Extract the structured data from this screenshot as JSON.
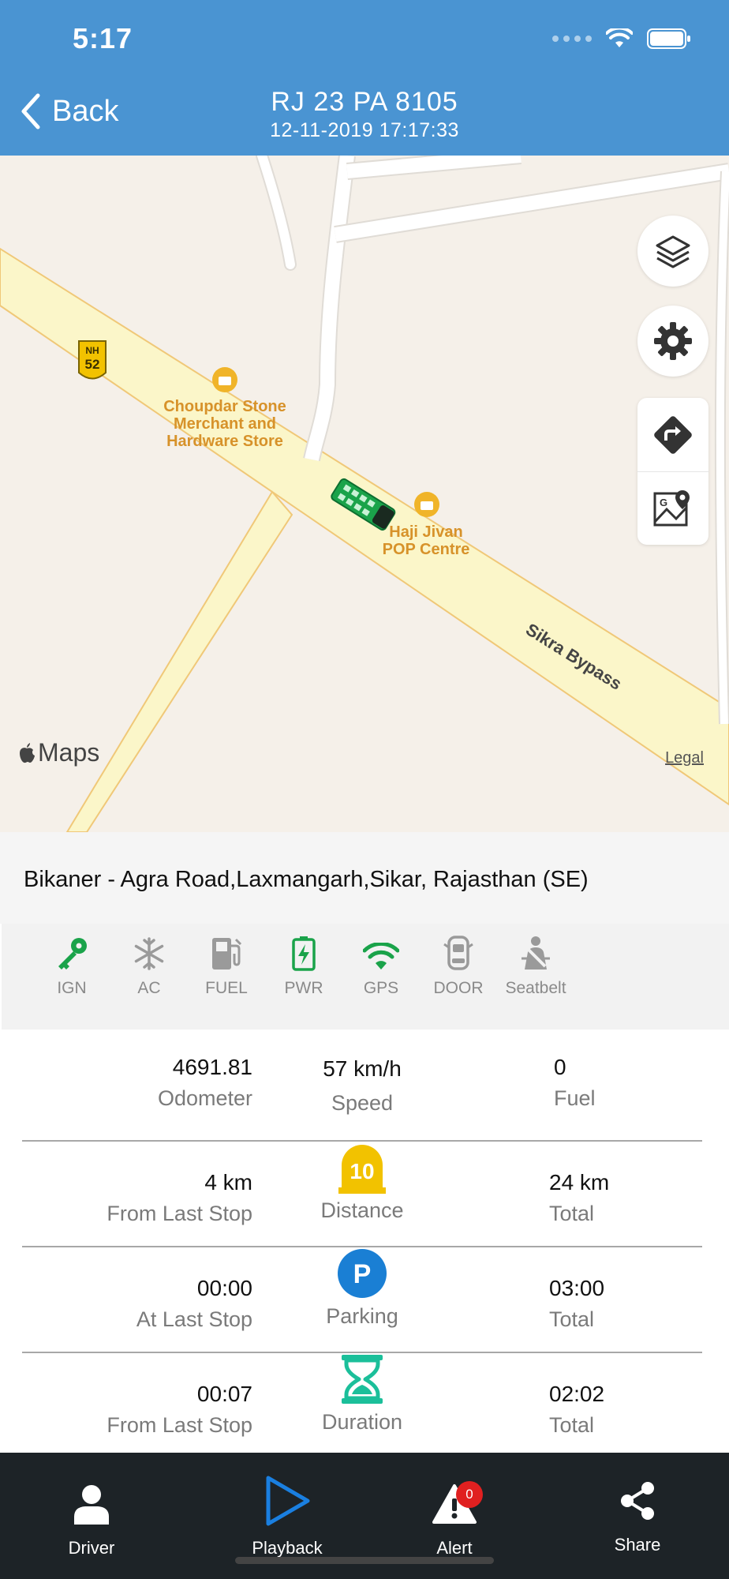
{
  "status_bar": {
    "time": "5:17"
  },
  "header": {
    "back_label": "Back",
    "title": "RJ 23 PA 8105",
    "subtitle": "12-11-2019 17:17:33"
  },
  "map": {
    "shield_top": "NH",
    "shield_num": "52",
    "poi_1": [
      "Choupdar Stone",
      "Merchant and",
      "Hardware Store"
    ],
    "poi_2": [
      "Haji Jivan",
      "POP Centre"
    ],
    "road_label": "Sikra Bypass",
    "maps_brand": "Maps",
    "legal": "Legal"
  },
  "address": "Bikaner - Agra Road,Laxmangarh,Sikar, Rajasthan (SE)",
  "sensors": [
    {
      "label": "IGN",
      "icon": "key-icon",
      "color": "#1aa34a"
    },
    {
      "label": "AC",
      "icon": "snowflake-icon",
      "color": "#9a9a9a"
    },
    {
      "label": "FUEL",
      "icon": "fuel-pump-icon",
      "color": "#9a9a9a"
    },
    {
      "label": "PWR",
      "icon": "battery-charging-icon",
      "color": "#1aa34a"
    },
    {
      "label": "GPS",
      "icon": "wifi-icon",
      "color": "#1aa34a"
    },
    {
      "label": "DOOR",
      "icon": "car-door-icon",
      "color": "#9a9a9a"
    },
    {
      "label": "Seatbelt",
      "icon": "seatbelt-icon",
      "color": "#9a9a9a"
    }
  ],
  "stats": {
    "odometer": {
      "value": "4691.81",
      "caption": "Odometer"
    },
    "speed": {
      "value": "57 km/h",
      "caption": "Speed"
    },
    "fuel": {
      "value": "0",
      "caption": "Fuel"
    },
    "distance": {
      "left_value": "4 km",
      "left_caption": "From Last Stop",
      "icon_number": "10",
      "caption": "Distance",
      "right_value": "24 km",
      "right_caption": "Total"
    },
    "parking": {
      "left_value": "00:00",
      "left_caption": "At Last Stop",
      "icon_letter": "P",
      "caption": "Parking",
      "right_value": "03:00",
      "right_caption": "Total"
    },
    "duration": {
      "left_value": "00:07",
      "left_caption": "From Last Stop",
      "caption": "Duration",
      "right_value": "02:02",
      "right_caption": "Total"
    }
  },
  "tabbar": {
    "driver": "Driver",
    "playback": "Playback",
    "alert": "Alert",
    "alert_badge": "0",
    "share": "Share"
  },
  "colors": {
    "header_bg": "#4a94d2",
    "active_green": "#1aa34a",
    "inactive_gray": "#9a9a9a",
    "distance_yellow": "#f2c200",
    "parking_blue": "#1a7fd4",
    "duration_teal": "#1bbf9a",
    "tabbar_bg": "#1d2327",
    "playback_blue": "#1a7fe0"
  }
}
